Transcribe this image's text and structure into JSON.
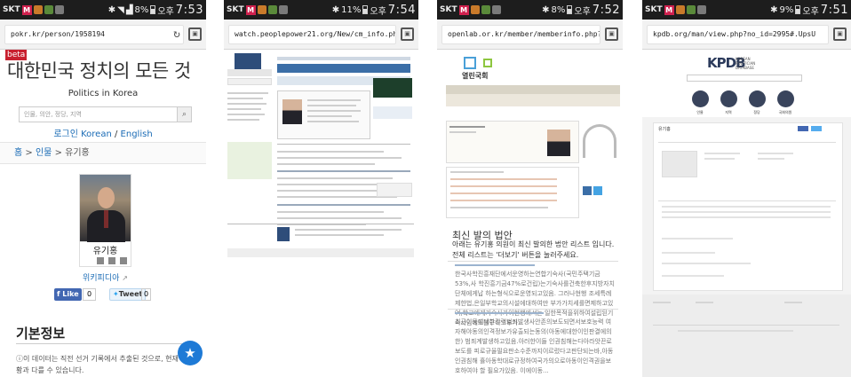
{
  "screens": [
    {
      "status": {
        "carrier": "SKT",
        "battery": "8%",
        "ampm": "오후",
        "time": "7:53"
      },
      "url": "pokr.kr/person/1958194",
      "page": {
        "beta": "beta",
        "title": "대한민국 정치의 모든 것",
        "subtitle": "Politics in Korea",
        "search_placeholder": "인물, 의안, 정당, 지역",
        "lang_korean": "로그인 Korean",
        "lang_sep": "/",
        "lang_english": "English",
        "breadcrumb": [
          "홈",
          ">",
          "인물",
          ">",
          "유기홍"
        ],
        "person_name": "유기홍",
        "wikipedia": "위키피디아",
        "fb_like": "Like",
        "fb_count": "0",
        "tweet": "Tweet",
        "tweet_count": "0",
        "section_title": "기본정보",
        "info_text": "이 데이터는 직전 선거 기록에서 추출된 것으로, 현재 상황과 다를 수 있습니다."
      }
    },
    {
      "status": {
        "carrier": "SKT",
        "battery": "11%",
        "ampm": "오후",
        "time": "7:54"
      },
      "url": "watch.peoplepower21.org/New/cm_info.php?"
    },
    {
      "status": {
        "carrier": "SKT",
        "battery": "8%",
        "ampm": "오후",
        "time": "7:52"
      },
      "url": "openlab.or.kr/member/memberinfo.php?ssn=",
      "page": {
        "brand": "열린국회",
        "recent_title": "최신 발의 법안",
        "recent_desc": "아래는 유기홍 의원이 최신 발의한 법안 리스트 입니다. 전체 리스트는 '더보기' 버튼을 눌러주세요.",
        "bill1": "한국사학진흥재단에서운영하는연합기숙사(국민주택기금53%,사 학진흥기금47%로건립)는기숙사를건축한후지방자치단체에게납 하는형식으로운영되고있음. 그러나현행 조세특례제한법,은일부학교의시설에대하여만 부가가치세를면제하고있어,학교에게기숙사가이현행에서는 일한목적을위하여설립된기숙사임에도불구하고부가...",
        "bill2": "최근이동에대한강력범죄발생사안존의보도되면서보호능력 여자해야동의인격정보가유출되는동의(아동에대한이인판결에의한) 범죄계발생하고있음.아러한이들 인권침해는다아라앗끈로보도를 피로규율필요판소수준까지이르렀다고판단되는바,아동인권침해 휼아동학대로규정하여국가의으로아동이인격권을보호하여야 할 필요가있음. 이에이동..."
      }
    },
    {
      "status": {
        "carrier": "SKT",
        "battery": "9%",
        "ampm": "오후",
        "time": "7:51"
      },
      "url": "kpdb.org/man/view.php?no_id=2995#.UpsU",
      "page": {
        "logo": "KPDB",
        "logo_sub": [
          "KOREAN",
          "POLITICIAN",
          "DATABASE"
        ],
        "nav": [
          "인물",
          "지역",
          "정당",
          "국회의원"
        ],
        "person_name": "유기홍"
      }
    }
  ],
  "colors": {
    "status_bar": "#1d1d1d",
    "url_bar": "#f2f2f2",
    "link": "#1a6bb5",
    "beta_badge": "#c8202f",
    "fb_blue": "#4267b2",
    "fab": "#1e7ad6"
  }
}
